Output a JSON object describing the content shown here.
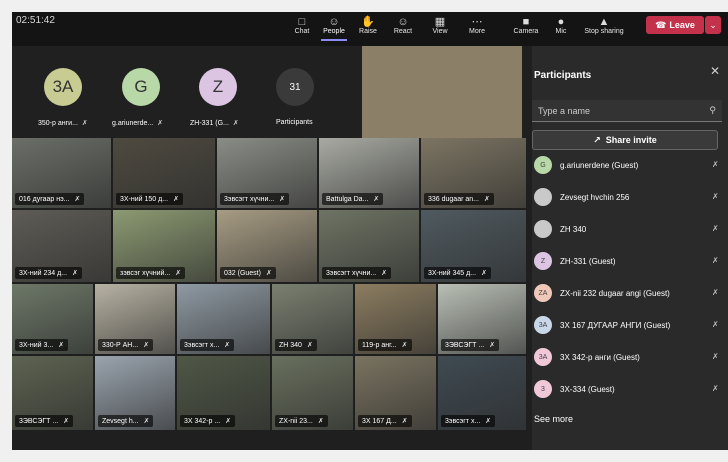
{
  "clock": "02:51:42",
  "toolbar": {
    "chat": "Chat",
    "people": "People",
    "raise": "Raise",
    "react": "React",
    "view": "View",
    "more": "More",
    "camera": "Camera",
    "mic": "Mic",
    "stop_sharing": "Stop sharing",
    "leave": "Leave"
  },
  "avatars": [
    {
      "initials": "3A",
      "label": "350-р анги...",
      "color": "#c9cc92"
    },
    {
      "initials": "G",
      "label": "g.ariunerde...",
      "color": "#b8d8a8"
    },
    {
      "initials": "Z",
      "label": "ZH-331 (G...",
      "color": "#dcc5e2"
    },
    {
      "initials": "31",
      "label": "Participants",
      "color": "#3a3a3a"
    }
  ],
  "tiles": [
    {
      "label": "016 дугаар нэ...",
      "bg": "#6b6f68"
    },
    {
      "label": "3X-ний 150 д...",
      "bg": "#4e4a40"
    },
    {
      "label": "3эвсэгт хүчни...",
      "bg": "#8a8d86"
    },
    {
      "label": "Battulga Da...",
      "bg": "#a8aaa2"
    },
    {
      "label": "336 dugaar an...",
      "bg": "#7d7563"
    },
    {
      "label": "3X-ний 234 д...",
      "bg": "#5e5c55"
    },
    {
      "label": "зэвсэг хүчний...",
      "bg": "#8c9a72"
    },
    {
      "label": "032 (Guest)",
      "bg": "#a79c83"
    },
    {
      "label": "3эвсэгт хүчни...",
      "bg": "#6e7464"
    },
    {
      "label": "3X-ний 345 д...",
      "bg": "#4f5a60"
    },
    {
      "label": "3X-ний 3...",
      "bg": "#6d7868"
    },
    {
      "label": "330-Р АН...",
      "bg": "#b7b2a3"
    },
    {
      "label": "3эвсэгт х...",
      "bg": "#8f9aa3"
    },
    {
      "label": "ZH 340",
      "bg": "#7a8070"
    },
    {
      "label": "119-р анг...",
      "bg": "#8c7d60"
    },
    {
      "label": "3ЭВСЭГТ ...",
      "bg": "#b9bfb5"
    },
    {
      "label": "3ЭВСЭГТ ...",
      "bg": "#5d6351"
    },
    {
      "label": "Zevsegt h...",
      "bg": "#9aa4ae"
    },
    {
      "label": "3X 342-р ...",
      "bg": "#4f5746"
    },
    {
      "label": "ZX-nii 23...",
      "bg": "#69705e"
    },
    {
      "label": "3X 167 Д...",
      "bg": "#7a7360"
    },
    {
      "label": "3эвсэгт х...",
      "bg": "#3f4a52"
    }
  ],
  "panel": {
    "title": "Participants",
    "search_placeholder": "Type a name",
    "share_invite": "Share invite",
    "participants": [
      {
        "initials": "G",
        "name": "g.ariunerdene (Guest)",
        "color": "#b8d8a8"
      },
      {
        "initials": "",
        "name": "Zevsegt hvchin 256",
        "color": "#c9c9c9"
      },
      {
        "initials": "",
        "name": "ZH 340",
        "color": "#c9c9c9"
      },
      {
        "initials": "Z",
        "name": "ZH-331 (Guest)",
        "color": "#dcc5e2"
      },
      {
        "initials": "ZA",
        "name": "ZX-nii 232 dugaar angi (Guest)",
        "color": "#f0c8b8"
      },
      {
        "initials": "3A",
        "name": "3X 167 ДУГААР АНГИ (Guest)",
        "color": "#c8d8e8"
      },
      {
        "initials": "3A",
        "name": "3X 342-р анги (Guest)",
        "color": "#f0c8d8"
      },
      {
        "initials": "3",
        "name": "3X-334 (Guest)",
        "color": "#f0c8d8"
      }
    ],
    "see_more": "See more"
  }
}
